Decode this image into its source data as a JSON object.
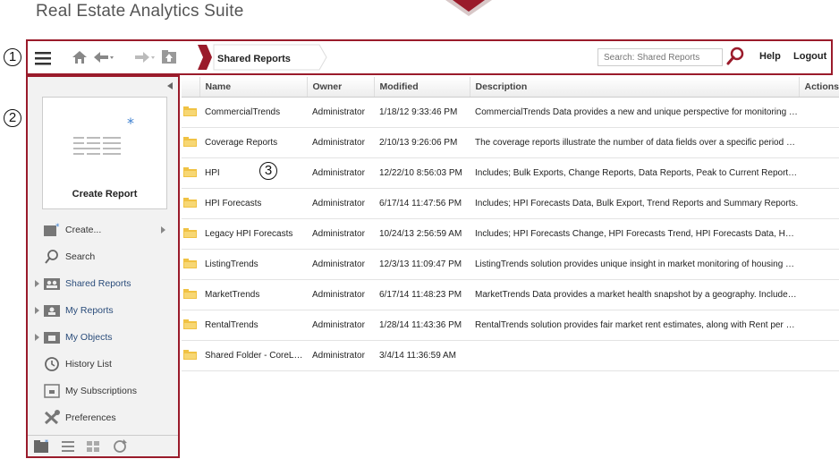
{
  "app": {
    "title": "Real Estate Analytics Suite"
  },
  "callouts": [
    "1",
    "2",
    "3"
  ],
  "toolbar": {
    "menu_icon": "hamburger-menu-icon",
    "breadcrumb": "Shared Reports",
    "search_placeholder": "Search: Shared Reports",
    "help_label": "Help",
    "logout_label": "Logout"
  },
  "sidebar": {
    "create_card_label": "Create Report",
    "items": [
      {
        "label": "Create...",
        "icon": "create-icon",
        "has_submenu": true
      },
      {
        "label": "Search",
        "icon": "search-icon"
      },
      {
        "label": "Shared Reports",
        "icon": "shared-reports-icon",
        "expandable": true
      },
      {
        "label": "My Reports",
        "icon": "my-reports-icon",
        "expandable": true
      },
      {
        "label": "My Objects",
        "icon": "my-objects-icon",
        "expandable": true
      },
      {
        "label": "History List",
        "icon": "history-icon"
      },
      {
        "label": "My Subscriptions",
        "icon": "subscriptions-icon"
      },
      {
        "label": "Preferences",
        "icon": "preferences-icon"
      }
    ]
  },
  "table": {
    "columns": [
      "Name",
      "Owner",
      "Modified",
      "Description",
      "Actions"
    ],
    "rows": [
      {
        "name": "CommercialTrends",
        "owner": "Administrator",
        "modified": "1/18/12 9:33:46 PM",
        "description": "CommercialTrends Data provides a new and unique perspective for monitoring and an..."
      },
      {
        "name": "Coverage Reports",
        "owner": "Administrator",
        "modified": "2/10/13 9:26:06 PM",
        "description": "The coverage reports illustrate the number of data fields over a specific period of time..."
      },
      {
        "name": "HPI",
        "owner": "Administrator",
        "modified": "12/22/10 8:56:03 PM",
        "description": "Includes; Bulk Exports, Change Reports, Data Reports, Peak to Current Reports, Sum..."
      },
      {
        "name": "HPI Forecasts",
        "owner": "Administrator",
        "modified": "6/17/14 11:47:56 PM",
        "description": "Includes; HPI Forecasts Data, Bulk Export, Trend Reports and Summary Reports."
      },
      {
        "name": "Legacy HPI Forecasts",
        "owner": "Administrator",
        "modified": "10/24/13 2:56:59 AM",
        "description": "Includes; HPI Forecasts Change, HPI Forecasts Trend, HPI Forecasts Data, HPI Forec..."
      },
      {
        "name": "ListingTrends",
        "owner": "Administrator",
        "modified": "12/3/13 11:09:47 PM",
        "description": "ListingTrends solution provides unique insight in market monitoring of housing supply,..."
      },
      {
        "name": "MarketTrends",
        "owner": "Administrator",
        "modified": "6/17/14 11:48:23 PM",
        "description": "MarketTrends Data provides a market health snapshot by a geography. Includes; Deli..."
      },
      {
        "name": "RentalTrends",
        "owner": "Administrator",
        "modified": "1/28/14 11:43:36 PM",
        "description": "RentalTrends solution provides fair market rent estimates, along with Rent per square..."
      },
      {
        "name": "Shared Folder - CoreLogic",
        "owner": "Administrator",
        "modified": "3/4/14 11:36:59 AM",
        "description": ""
      }
    ]
  },
  "colors": {
    "accent": "#9a1b2b",
    "folder": "#f0c243",
    "link": "#2a4c7a"
  }
}
